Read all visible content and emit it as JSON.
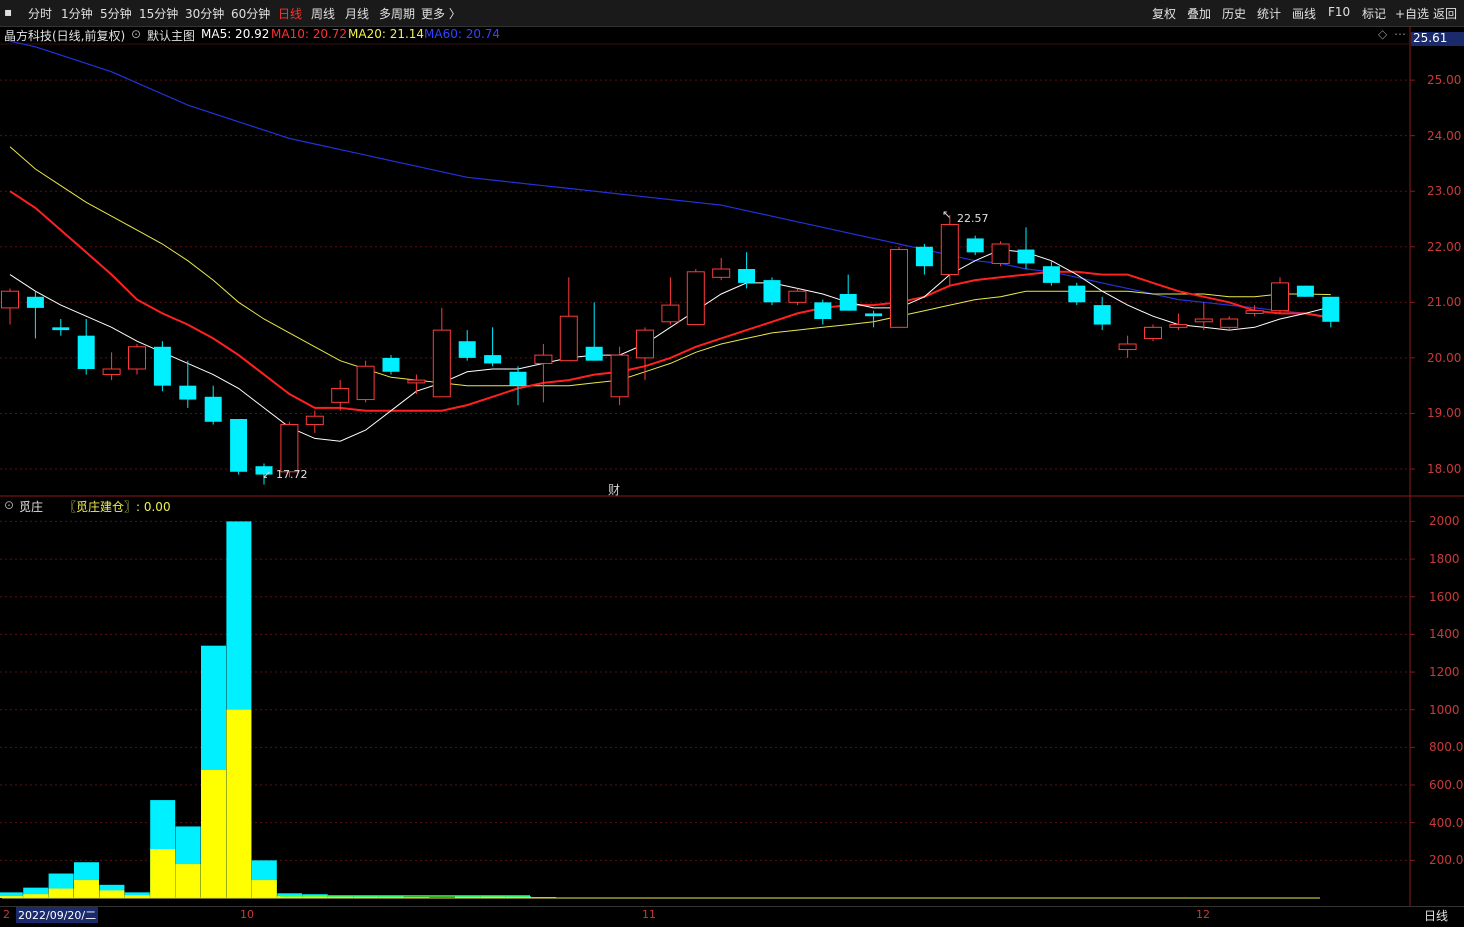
{
  "toolbar": {
    "periods": [
      "分时",
      "1分钟",
      "5分钟",
      "15分钟",
      "30分钟",
      "60分钟",
      "日线",
      "周线",
      "月线",
      "多周期",
      "更多 〉"
    ],
    "active_period": "日线",
    "right_items": [
      "复权",
      "叠加",
      "历史",
      "统计",
      "画线",
      "F10",
      "标记",
      "+自选",
      "返回"
    ]
  },
  "stock": {
    "title": "晶方科技(日线,前复权)",
    "template": "默认主图",
    "ma5": "MA5: 20.92",
    "ma10": "MA10: 20.72",
    "ma20": "MA20: 21.14",
    "ma60": "MA60: 20.74",
    "price_tag": "25.61",
    "high_label": "22.57",
    "low_label": "17.72",
    "fin_marker": "财",
    "colors": {
      "up": "#ff3b3b",
      "down": "#00f0ff",
      "ma5": "#ffffff",
      "ma10": "#ff2020",
      "ma20": "#e8e84a",
      "ma60": "#2233dd"
    }
  },
  "price_axis": [
    "25.00",
    "24.00",
    "23.00",
    "22.00",
    "21.00",
    "20.00",
    "19.00",
    "18.00"
  ],
  "indicator": {
    "name": "觅庄",
    "formula": "〖觅庄建仓〗: 0.00",
    "axis": [
      "2000",
      "1800",
      "1600",
      "1400",
      "1200",
      "1000",
      "800.0",
      "600.0",
      "400.0",
      "200.0"
    ]
  },
  "date_axis": {
    "start_marker": "2",
    "start_date": "2022/09/20/二",
    "labels": [
      "10",
      "11",
      "12"
    ],
    "period_tag": "日线"
  },
  "chart_data": {
    "type": "candlestick",
    "candles": [
      {
        "o": 20.9,
        "c": 21.2,
        "h": 21.25,
        "l": 20.6
      },
      {
        "o": 21.1,
        "c": 20.9,
        "h": 21.2,
        "l": 20.35
      },
      {
        "o": 20.55,
        "c": 20.5,
        "h": 20.7,
        "l": 20.4
      },
      {
        "o": 20.4,
        "c": 19.8,
        "h": 20.7,
        "l": 19.7
      },
      {
        "o": 19.7,
        "c": 19.8,
        "h": 20.1,
        "l": 19.6
      },
      {
        "o": 19.8,
        "c": 20.2,
        "h": 20.25,
        "l": 19.7
      },
      {
        "o": 20.2,
        "c": 19.5,
        "h": 20.3,
        "l": 19.4
      },
      {
        "o": 19.5,
        "c": 19.25,
        "h": 19.95,
        "l": 19.1
      },
      {
        "o": 19.3,
        "c": 18.85,
        "h": 19.5,
        "l": 18.8
      },
      {
        "o": 18.9,
        "c": 17.95,
        "h": 18.9,
        "l": 17.9
      },
      {
        "o": 18.05,
        "c": 17.9,
        "h": 18.1,
        "l": 17.72
      },
      {
        "o": 17.95,
        "c": 18.8,
        "h": 18.85,
        "l": 17.85
      },
      {
        "o": 18.8,
        "c": 18.95,
        "h": 19.05,
        "l": 18.65
      },
      {
        "o": 19.2,
        "c": 19.45,
        "h": 19.6,
        "l": 19.05
      },
      {
        "o": 19.25,
        "c": 19.85,
        "h": 19.95,
        "l": 19.2
      },
      {
        "o": 20.0,
        "c": 19.75,
        "h": 20.05,
        "l": 19.7
      },
      {
        "o": 19.55,
        "c": 19.6,
        "h": 19.7,
        "l": 19.35
      },
      {
        "o": 19.3,
        "c": 20.5,
        "h": 20.9,
        "l": 19.3
      },
      {
        "o": 20.3,
        "c": 20.0,
        "h": 20.5,
        "l": 19.95
      },
      {
        "o": 20.05,
        "c": 19.9,
        "h": 20.55,
        "l": 19.85
      },
      {
        "o": 19.75,
        "c": 19.5,
        "h": 19.85,
        "l": 19.15
      },
      {
        "o": 19.9,
        "c": 20.05,
        "h": 20.25,
        "l": 19.2
      },
      {
        "o": 19.95,
        "c": 20.75,
        "h": 21.45,
        "l": 19.95
      },
      {
        "o": 20.2,
        "c": 19.95,
        "h": 21.0,
        "l": 19.95
      },
      {
        "o": 19.3,
        "c": 20.05,
        "h": 20.2,
        "l": 19.15
      },
      {
        "o": 20.0,
        "c": 20.5,
        "h": 20.55,
        "l": 19.6
      },
      {
        "o": 20.65,
        "c": 20.95,
        "h": 21.45,
        "l": 20.6
      },
      {
        "o": 20.6,
        "c": 21.55,
        "h": 21.6,
        "l": 20.6
      },
      {
        "o": 21.45,
        "c": 21.6,
        "h": 21.8,
        "l": 21.4
      },
      {
        "o": 21.6,
        "c": 21.35,
        "h": 21.9,
        "l": 21.25
      },
      {
        "o": 21.4,
        "c": 21.0,
        "h": 21.45,
        "l": 20.95
      },
      {
        "o": 21.0,
        "c": 21.2,
        "h": 21.25,
        "l": 20.95
      },
      {
        "o": 21.0,
        "c": 20.7,
        "h": 21.05,
        "l": 20.6
      },
      {
        "o": 21.15,
        "c": 20.85,
        "h": 21.5,
        "l": 20.85
      },
      {
        "o": 20.8,
        "c": 20.75,
        "h": 20.85,
        "l": 20.55
      },
      {
        "o": 20.55,
        "c": 21.95,
        "h": 22.0,
        "l": 20.55
      },
      {
        "o": 22.0,
        "c": 21.65,
        "h": 22.05,
        "l": 21.5
      },
      {
        "o": 21.5,
        "c": 22.4,
        "h": 22.57,
        "l": 21.3
      },
      {
        "o": 22.15,
        "c": 21.9,
        "h": 22.2,
        "l": 21.85
      },
      {
        "o": 21.7,
        "c": 22.05,
        "h": 22.1,
        "l": 21.65
      },
      {
        "o": 21.95,
        "c": 21.7,
        "h": 22.35,
        "l": 21.6
      },
      {
        "o": 21.65,
        "c": 21.35,
        "h": 21.75,
        "l": 21.3
      },
      {
        "o": 21.3,
        "c": 21.0,
        "h": 21.35,
        "l": 20.95
      },
      {
        "o": 20.95,
        "c": 20.6,
        "h": 21.1,
        "l": 20.5
      },
      {
        "o": 20.15,
        "c": 20.25,
        "h": 20.4,
        "l": 20.0
      },
      {
        "o": 20.35,
        "c": 20.55,
        "h": 20.6,
        "l": 20.3
      },
      {
        "o": 20.55,
        "c": 20.6,
        "h": 20.8,
        "l": 20.5
      },
      {
        "o": 20.65,
        "c": 20.7,
        "h": 21.0,
        "l": 20.5
      },
      {
        "o": 20.55,
        "c": 20.7,
        "h": 20.75,
        "l": 20.5
      },
      {
        "o": 20.8,
        "c": 20.85,
        "h": 20.95,
        "l": 20.75
      },
      {
        "o": 20.85,
        "c": 21.35,
        "h": 21.45,
        "l": 20.8
      },
      {
        "o": 21.3,
        "c": 21.1,
        "h": 21.3,
        "l": 21.1
      },
      {
        "o": 21.1,
        "c": 20.65,
        "h": 21.1,
        "l": 20.55
      }
    ],
    "ma5": [
      21.5,
      21.2,
      20.95,
      20.75,
      20.55,
      20.3,
      20.1,
      19.9,
      19.7,
      19.45,
      19.1,
      18.75,
      18.55,
      18.5,
      18.7,
      19.05,
      19.4,
      19.55,
      19.75,
      19.8,
      19.8,
      19.9,
      20.0,
      20.05,
      20.05,
      20.25,
      20.55,
      20.85,
      21.15,
      21.35,
      21.35,
      21.25,
      21.15,
      21.0,
      20.9,
      20.9,
      21.1,
      21.5,
      21.75,
      21.95,
      21.9,
      21.75,
      21.5,
      21.2,
      20.95,
      20.75,
      20.6,
      20.55,
      20.5,
      20.55,
      20.7,
      20.8,
      20.92
    ],
    "ma10": [
      23.0,
      22.7,
      22.3,
      21.9,
      21.5,
      21.05,
      20.8,
      20.6,
      20.35,
      20.05,
      19.7,
      19.35,
      19.1,
      19.1,
      19.05,
      19.05,
      19.05,
      19.05,
      19.15,
      19.3,
      19.45,
      19.55,
      19.6,
      19.7,
      19.75,
      19.85,
      20.0,
      20.2,
      20.35,
      20.5,
      20.65,
      20.8,
      20.9,
      20.95,
      20.95,
      21.0,
      21.1,
      21.3,
      21.4,
      21.45,
      21.5,
      21.55,
      21.55,
      21.5,
      21.5,
      21.35,
      21.2,
      21.1,
      21.0,
      20.85,
      20.8,
      20.8,
      20.72
    ],
    "ma20": [
      23.8,
      23.4,
      23.1,
      22.8,
      22.55,
      22.3,
      22.05,
      21.75,
      21.4,
      21.0,
      20.7,
      20.45,
      20.2,
      19.95,
      19.8,
      19.65,
      19.6,
      19.55,
      19.5,
      19.5,
      19.5,
      19.5,
      19.5,
      19.55,
      19.6,
      19.75,
      19.9,
      20.1,
      20.25,
      20.35,
      20.45,
      20.5,
      20.55,
      20.6,
      20.65,
      20.75,
      20.85,
      20.95,
      21.05,
      21.1,
      21.2,
      21.2,
      21.2,
      21.2,
      21.2,
      21.15,
      21.15,
      21.15,
      21.1,
      21.1,
      21.15,
      21.15,
      21.14
    ],
    "ma60": [
      25.7,
      25.6,
      25.45,
      25.3,
      25.15,
      24.95,
      24.75,
      24.55,
      24.4,
      24.25,
      24.1,
      23.95,
      23.85,
      23.75,
      23.65,
      23.55,
      23.45,
      23.35,
      23.25,
      23.2,
      23.15,
      23.1,
      23.05,
      23.0,
      22.95,
      22.9,
      22.85,
      22.8,
      22.75,
      22.65,
      22.55,
      22.45,
      22.35,
      22.25,
      22.15,
      22.05,
      21.95,
      21.85,
      21.75,
      21.7,
      21.6,
      21.55,
      21.45,
      21.35,
      21.25,
      21.15,
      21.05,
      21.0,
      20.95,
      20.9,
      20.85,
      20.8,
      20.74
    ],
    "indicator_cyan": [
      30,
      55,
      130,
      190,
      70,
      30,
      520,
      380,
      1340,
      2000,
      200,
      25,
      20,
      12,
      10,
      8,
      5,
      3,
      10,
      12,
      10,
      5,
      2,
      0,
      0,
      0,
      0,
      0,
      0,
      0,
      0,
      0,
      0,
      0,
      0,
      0,
      0,
      0,
      0,
      0,
      0,
      0,
      0,
      0,
      0,
      0,
      0,
      0,
      0,
      0,
      0,
      0,
      0
    ],
    "indicator_yellow": [
      10,
      20,
      50,
      95,
      40,
      15,
      260,
      180,
      680,
      1000,
      95,
      10,
      8,
      6,
      5,
      4,
      3,
      2,
      5,
      6,
      5,
      2,
      1,
      0,
      0,
      0,
      0,
      0,
      0,
      0,
      0,
      0,
      0,
      0,
      0,
      0,
      0,
      0,
      0,
      0,
      0,
      0,
      0,
      0,
      0,
      0,
      0,
      0,
      0,
      0,
      0,
      0,
      0
    ],
    "price_range": [
      17.5,
      25.8
    ],
    "indicator_range": [
      0,
      2050
    ]
  }
}
